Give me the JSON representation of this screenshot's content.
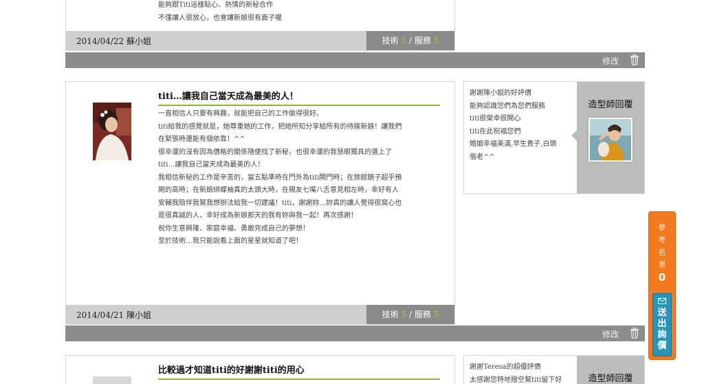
{
  "reviews": [
    {
      "body_lines": [
        "能夠跟Titi這樣貼心、熱情的新秘合作",
        "不僅讓人很放心，也會讓新娘很有面子喔"
      ],
      "date": "2014/04/22",
      "reviewer": "蘇小姐",
      "score_label_tech": "技術",
      "score_tech": "5",
      "score_sep": " / ",
      "score_label_service": "服務",
      "score_service": "5",
      "edit_label": "修改"
    },
    {
      "title": "titi…讓我自己當天成為最美的人！",
      "body_lines": [
        "一直相信人只要有興趣，就能把自己的工作做得很好。",
        "titi給我的感覺就是，她尊重她的工作，把她所知分享給所有的待嫁新娘！讓我們",
        "在緊張時還能有個依靠！^^",
        "很幸運的沒有因為價格的關係隨便找了新秘，也很幸運的我慧眼獨具的選上了",
        "titi…讓我自己當天成為最美的人！",
        "我相信新秘的工作是辛苦的，當五點準時在門外為titi開門時；在旅館鏡子超乎預",
        "期的高時；在新娘綁蝶袖真的太頭大時，在親友七嘴八舌意見相左時，幸好有人",
        "安輔我陪伴我幫我想辦法給我一切建議！titi，謝謝妳…妳真的讓人覺得很窩心也",
        "是很真誠的人，幸好成為新娘那天的我有妳與我一起！再次感謝！",
        "祝你生意興隆、家庭幸福、勇敢完成自己的夢想！",
        "至於技術…我只能說看上面的星星就知道了吧！"
      ],
      "date": "2014/04/21",
      "reviewer": "陳小姐",
      "score_label_tech": "技術",
      "score_tech": "5",
      "score_sep": " / ",
      "score_label_service": "服務",
      "score_service": "5",
      "edit_label": "修改",
      "reply_lines": [
        "謝謝陳小姐的好評價",
        "能夠認識您們為您們服務",
        "titi很榮幸很開心",
        "titi在此祝福您們",
        "婚姻幸福美滿,早生貴子,白頭",
        "偕老^^"
      ],
      "stylist_title": "造型師回覆"
    },
    {
      "title": "比較過才知道titi的好謝謝titi的用心",
      "reply_lines": [
        "謝謝Teresa的超優評價",
        "太感謝您特地撥空幫titi留下好"
      ],
      "stylist_title": "造型師回覆"
    }
  ],
  "side_widget": {
    "ref_chars": [
      "參",
      "考",
      "名",
      "單"
    ],
    "ref_count": "0",
    "inquiry_chars": [
      "送",
      "出",
      "詢",
      "價"
    ]
  },
  "colors": {
    "accent_green": "#8cb82b",
    "score_green": "#a8cc3a",
    "widget_orange": "#f27a20",
    "inquiry_blue": "#2a93b8"
  }
}
